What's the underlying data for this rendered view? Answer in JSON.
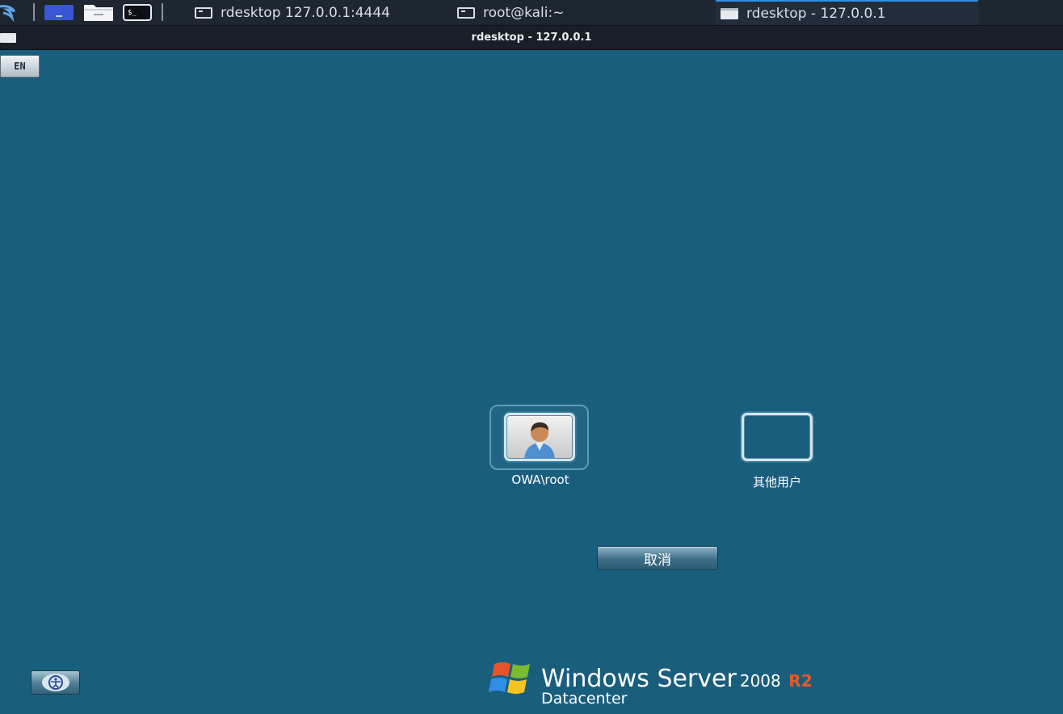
{
  "taskbar": {
    "tasks": [
      {
        "label": "rdesktop 127.0.0.1:4444",
        "icon": "terminal-icon"
      },
      {
        "label": "root@kali:~",
        "icon": "terminal-icon"
      },
      {
        "label": "rdesktop - 127.0.0.1",
        "icon": "window-icon",
        "active": true
      }
    ]
  },
  "window": {
    "title": "rdesktop - 127.0.0.1"
  },
  "logon": {
    "keyboard_layout": "EN",
    "users": [
      {
        "label": "OWA\\root",
        "icon": "user-avatar-icon"
      },
      {
        "label": "其他用户",
        "icon": "other-user-icon"
      }
    ],
    "cancel_label": "取消",
    "ease_of_access_icon": "ease-of-access-icon"
  },
  "branding": {
    "product": "Windows Server",
    "version": "2008",
    "release": "R2",
    "edition": "Datacenter"
  },
  "colors": {
    "desktop_bg": "#1a5e7e",
    "taskbar_bg": "#1e2630",
    "active_task_accent": "#2f8ee8",
    "r2_accent": "#e25b2a"
  }
}
